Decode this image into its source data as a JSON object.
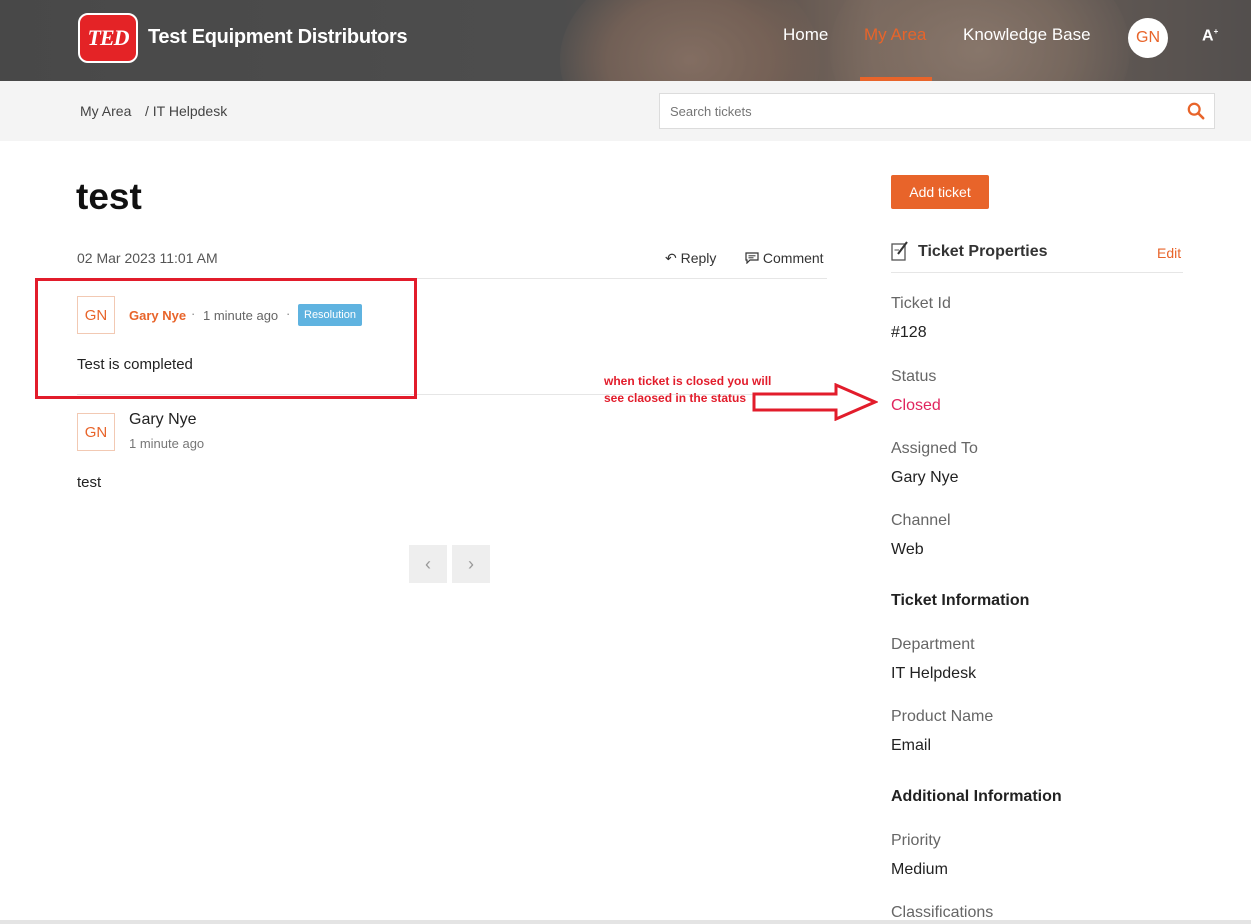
{
  "header": {
    "logo_text": "TED",
    "brand": "Test Equipment Distributors",
    "nav": [
      {
        "label": "Home",
        "active": false
      },
      {
        "label": "My Area",
        "active": true
      },
      {
        "label": "Knowledge Base",
        "active": false
      }
    ],
    "avatar": "GN",
    "accessibility": "A"
  },
  "breadcrumb": {
    "items": [
      "My Area",
      "/ IT Helpdesk"
    ]
  },
  "search": {
    "placeholder": "Search tickets"
  },
  "ticket": {
    "title": "test",
    "date": "02 Mar 2023 11:01 AM",
    "reply_label": "Reply",
    "comment_label": "Comment",
    "threads": [
      {
        "avatar": "GN",
        "author": "Gary Nye",
        "time": "1 minute ago",
        "badge": "Resolution",
        "body": "Test is completed"
      },
      {
        "avatar": "GN",
        "author": "Gary Nye",
        "time": "1 minute ago",
        "body": "test"
      }
    ],
    "pager": {
      "prev": "‹",
      "next": "›"
    }
  },
  "annotation": {
    "text": "when ticket is closed you will see claosed in the status",
    "color": "#e21c2b"
  },
  "sidebar": {
    "add_button": "Add ticket",
    "properties_title": "Ticket Properties",
    "edit_label": "Edit",
    "fields": [
      {
        "label": "Ticket Id",
        "value": "#128"
      },
      {
        "label": "Status",
        "value": "Closed"
      },
      {
        "label": "Assigned To",
        "value": "Gary Nye"
      },
      {
        "label": "Channel",
        "value": "Web"
      }
    ],
    "info_title": "Ticket Information",
    "info_fields": [
      {
        "label": "Department",
        "value": "IT Helpdesk"
      },
      {
        "label": "Product Name",
        "value": "Email"
      }
    ],
    "additional_title": "Additional Information",
    "additional_fields": [
      {
        "label": "Priority",
        "value": "Medium"
      },
      {
        "label": "Classifications",
        "value": ""
      }
    ]
  },
  "colors": {
    "accent": "#e8642a",
    "status_closed": "#e0245e",
    "badge": "#5fb3e0"
  }
}
